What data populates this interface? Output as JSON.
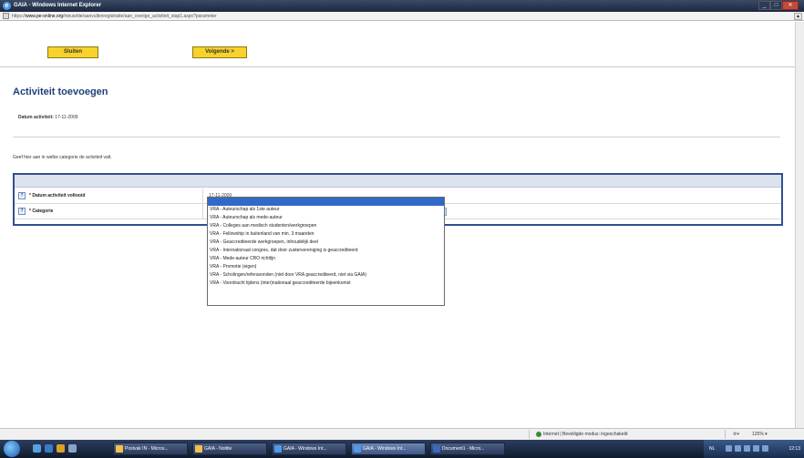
{
  "window": {
    "title": "GAIA - Windows Internet Explorer",
    "controls": {
      "minimize": "_",
      "maximize": "□",
      "close": "✕"
    }
  },
  "address": {
    "prefix": "https://",
    "host": "www.pe-online.org",
    "path": "/nieuw/de/aanvullenregistratie/aan_overige_activiteit_stap1.aspx?parameter"
  },
  "toolbar": {
    "close_label": "Sluiten",
    "next_label": "Volgende >"
  },
  "page": {
    "title": "Activiteit toevoegen",
    "date_label": "Datum activiteit:",
    "date_value": "17-11-2009",
    "instruction": "Geef hier aan in welke categorie de activiteit valt."
  },
  "form": {
    "help_icon": "?",
    "rows": [
      {
        "label": "* Datum activiteit voltooid",
        "value": "17-11-2009"
      },
      {
        "label": "* Categorie",
        "value": ""
      }
    ],
    "select_arrow": "▾"
  },
  "dropdown": {
    "options": [
      "",
      "VRA - Auteurschap als 1ste auteur",
      "VRA - Auteurschap als mede-auteur",
      "VRA - Colleges aan medisch studenten/werkgroepen",
      "VRA - Fellowship in buitenland van min. 3 maanden",
      "VRA - Geaccrediteerde werkgroepen, inhoudelijk deel",
      "VRA - Internationaal congres, dat door zustervereniging is geaccrediteerd",
      "VRA - Mede-auteur CBO richtlijn",
      "VRA - Promotie (eigen)",
      "VRA - Scholingen/referavonden (niet door VRA geaccrediteerd, niet via GAIA)",
      "VRA - Voordracht tijdens (inter)nationaal geaccrediteerde bijeenkomst"
    ]
  },
  "statusbar": {
    "zone": "Internet | Beveiligde modus: ingeschakeld",
    "zoom": "125%"
  },
  "taskbar": {
    "items": [
      "Postvak IN - Micros...",
      "GAIA - Notitie",
      "GAIA - Windows Int...",
      "GAIA - Windows Int...",
      "Document1 - Micro..."
    ],
    "lang": "NL",
    "clock": "12:13"
  },
  "colors": {
    "button": "#f6d22a",
    "title_blue": "#1f3f7a",
    "form_border": "#2f4f8f",
    "selected_option": "#3169c6"
  }
}
